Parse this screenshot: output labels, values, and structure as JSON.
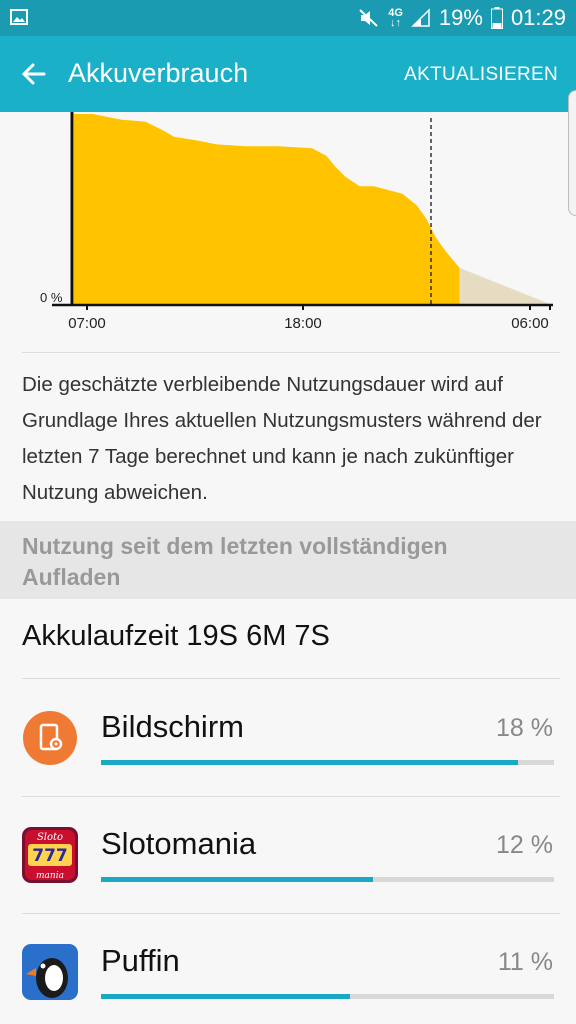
{
  "status_bar": {
    "battery_percent": "19%",
    "time": "01:29",
    "network_top": "4G",
    "network_bottom": "↓↑",
    "icons": [
      "image-notification-icon",
      "mute-icon",
      "signal-icon",
      "battery-icon"
    ]
  },
  "app_bar": {
    "title": "Akkuverbrauch",
    "refresh_label": "AKTUALISIEREN",
    "icon": "arrow-back-icon"
  },
  "chart_data": {
    "type": "area",
    "y_label_zero": "0 %",
    "x_tick_labels": [
      "07:00",
      "18:00",
      "06:00"
    ],
    "series": [
      {
        "kind": "actual",
        "color": "#ffc300",
        "points": [
          [
            0.0,
            100
          ],
          [
            0.04,
            100
          ],
          [
            0.1,
            97
          ],
          [
            0.15,
            96
          ],
          [
            0.19,
            91
          ],
          [
            0.21,
            88
          ],
          [
            0.26,
            86
          ],
          [
            0.3,
            84
          ],
          [
            0.36,
            83
          ],
          [
            0.43,
            83
          ],
          [
            0.5,
            82
          ],
          [
            0.53,
            78
          ],
          [
            0.55,
            72
          ],
          [
            0.57,
            67
          ],
          [
            0.6,
            62
          ],
          [
            0.63,
            62
          ],
          [
            0.69,
            58
          ],
          [
            0.72,
            52
          ],
          [
            0.74,
            45
          ],
          [
            0.76,
            35
          ],
          [
            0.78,
            28
          ],
          [
            0.8,
            22
          ],
          [
            0.81,
            19
          ]
        ]
      },
      {
        "kind": "estimate",
        "color": "#e6dcc2",
        "points": [
          [
            0.81,
            19
          ],
          [
            1.0,
            0
          ]
        ]
      }
    ],
    "now_marker_x": 0.75,
    "x_range_note": "x from 07:00 to 06:00 (fraction of timeline)",
    "ylim": [
      0,
      100
    ]
  },
  "description": "Die geschätzte verbleibende Nutzungsdauer wird auf Grundlage Ihres aktuellen Nutzungsmusters während der letzten 7 Tage berechnet und kann je nach zukünftiger Nutzung abweichen.",
  "section": {
    "title": "Nutzung seit dem letzten vollständigen Aufladen"
  },
  "uptime": "Akkulaufzeit 19S 6M 7S",
  "apps": [
    {
      "name": "Bildschirm",
      "percent_label": "18 %",
      "usage_fraction": 0.92,
      "icon": "screen-settings-icon",
      "color": "#ef7a33"
    },
    {
      "name": "Slotomania",
      "percent_label": "12 %",
      "usage_fraction": 0.6,
      "icon": "slotomania-app-icon",
      "color": "#c8102e"
    },
    {
      "name": "Puffin",
      "percent_label": "11 %",
      "usage_fraction": 0.55,
      "icon": "puffin-app-icon",
      "color": "#2a6fc9"
    }
  ]
}
